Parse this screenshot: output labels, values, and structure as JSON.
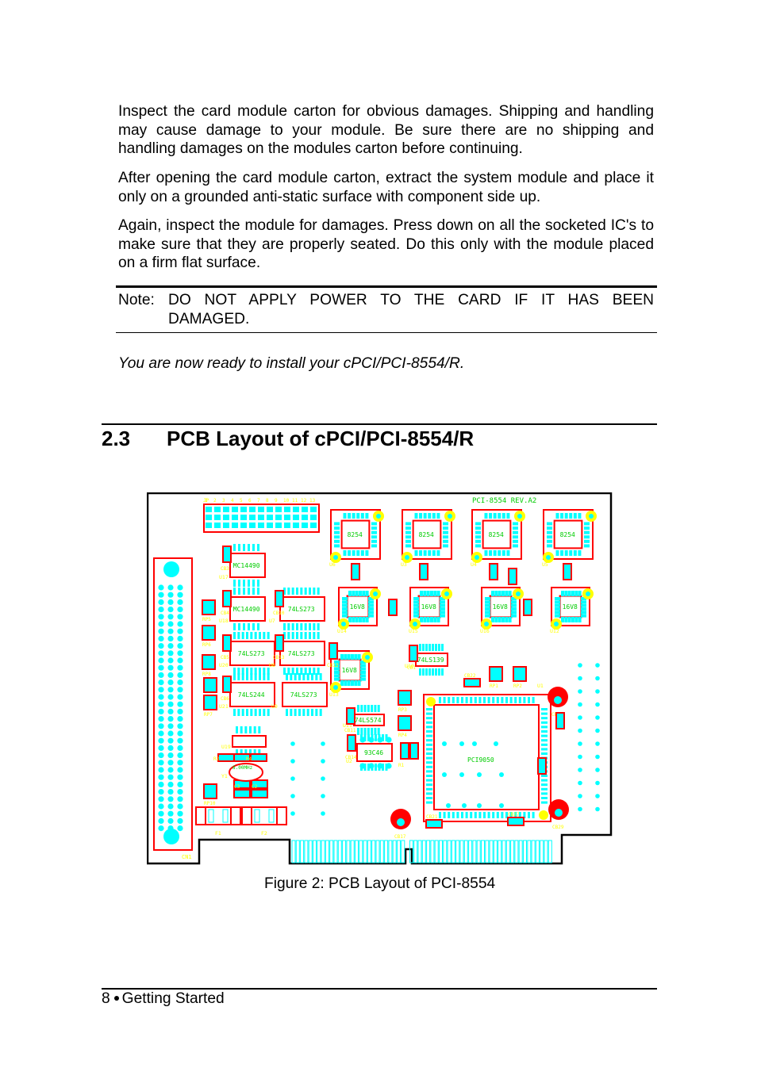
{
  "paragraphs": [
    "Inspect the card module carton for obvious damages. Shipping and handling may cause damage to your module.  Be sure there are no shipping and handling damages on the modules carton before continuing.",
    "After opening the card module carton, extract the system module and place it only on a grounded anti-static surface with component side up.",
    "Again, inspect the module for damages. Press down on all the socketed IC's to make sure that they are properly seated. Do this only with the module placed on a firm flat surface."
  ],
  "note": {
    "label": "Note:",
    "line1": "DO NOT APPLY POWER TO THE CARD IF IT HAS BEEN",
    "line2": "DAMAGED."
  },
  "ready_text": "You are now ready to install your cPCI/PCI-8554/R.",
  "section": {
    "number": "2.3",
    "title": "PCB Layout of cPCI/PCI-8554/R"
  },
  "figure": {
    "caption": "Figure 2:   PCB Layout of PCI-8554",
    "board_label": "PCI-8554   REV.A2",
    "colors": {
      "outline": "#000000",
      "component": "#ff0000",
      "pad": "#00ffff",
      "chip_label": "#00cc00",
      "silk_label": "#ffff00",
      "via": "#ffff00"
    },
    "jumpers": [
      "JP1",
      "JP2",
      "JP3",
      "JP4",
      "JP5",
      "JP6",
      "JP7",
      "JP8",
      "JP9",
      "JP10",
      "JP11",
      "JP12",
      "JP13"
    ],
    "chips": [
      {
        "label": "8254",
        "ref": "U6"
      },
      {
        "label": "8254",
        "ref": "U3"
      },
      {
        "label": "8254",
        "ref": "U4"
      },
      {
        "label": "8254",
        "ref": "U5"
      },
      {
        "label": "16V8",
        "ref": "U14"
      },
      {
        "label": "16V8",
        "ref": "U15"
      },
      {
        "label": "16V8",
        "ref": "U16"
      },
      {
        "label": "16V8",
        "ref": "U12"
      },
      {
        "label": "16V8",
        "ref": "U13"
      },
      {
        "label": "MC14490",
        "ref": "U17"
      },
      {
        "label": "MC14490",
        "ref": "U18"
      },
      {
        "label": "74LS273",
        "ref": "U7"
      },
      {
        "label": "74LS273",
        "ref": "U20"
      },
      {
        "label": "74LS273",
        "ref": "U8"
      },
      {
        "label": "74LS244",
        "ref": "U21"
      },
      {
        "label": "74LS273",
        "ref": "U9"
      },
      {
        "label": "74LS139",
        "ref": "U10"
      },
      {
        "label": "74LS574",
        "ref": "U11"
      },
      {
        "label": "93C46",
        "ref": "U2"
      },
      {
        "label": "PCI9050",
        "ref": "U1"
      },
      {
        "label": "",
        "ref": "U19"
      }
    ],
    "parts": {
      "caps": [
        "CB3",
        "CB4",
        "CB5",
        "CB6",
        "CB7",
        "CB8",
        "CB9",
        "CB10",
        "CB11",
        "CB12",
        "CB13",
        "CB14",
        "CB15",
        "CB16",
        "CB17",
        "CB18",
        "CB19",
        "CB20",
        "CB21",
        "CB22",
        "CB23",
        "CB24",
        "CB25",
        "CB26",
        "CB27",
        "CB28",
        "CB29",
        "CB1",
        "C1",
        "C2",
        "C3",
        "C4",
        "C5"
      ],
      "resistor_packs": [
        "RP1",
        "RP2",
        "RP3",
        "RP4",
        "RP5",
        "RP6",
        "RP7",
        "RP8",
        "RP9",
        "RP10"
      ],
      "resistors": [
        "R1",
        "R2",
        "R3",
        "R4"
      ],
      "crystal": {
        "ref": "Y1",
        "label": "8.00MHz"
      },
      "fuses": [
        "F1",
        "F2"
      ],
      "connector": "CN1"
    }
  },
  "footer": {
    "page_number": "8",
    "section_name": "Getting Started"
  }
}
